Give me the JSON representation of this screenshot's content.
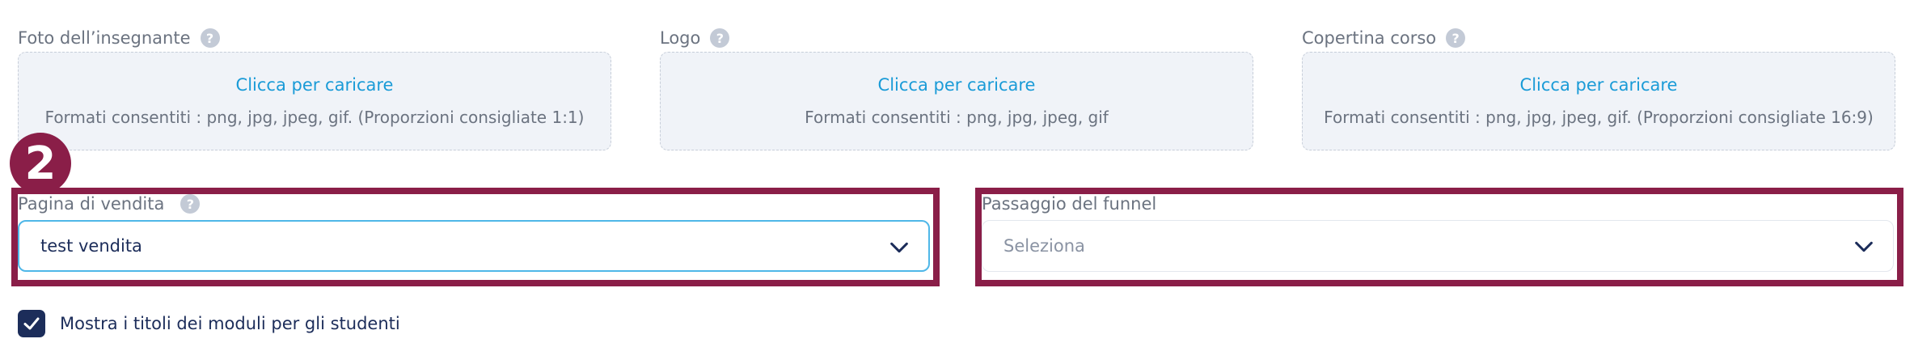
{
  "uploads": [
    {
      "label": "Foto dell’insegnante",
      "link": "Clicca per caricare",
      "hint": "Formati consentiti : png, jpg, jpeg, gif. (Proporzioni consigliate 1:1)"
    },
    {
      "label": "Logo",
      "link": "Clicca per caricare",
      "hint": "Formati consentiti : png, jpg, jpeg, gif"
    },
    {
      "label": "Copertina corso",
      "link": "Clicca per caricare",
      "hint": "Formati consentiti : png, jpg, jpeg, gif. (Proporzioni consigliate 16:9)"
    }
  ],
  "help_glyph": "?",
  "step_badge": "2",
  "sales_page": {
    "label": "Pagina di vendita",
    "value": "test vendita"
  },
  "funnel_step": {
    "label": "Passaggio del funnel",
    "placeholder": "Seleziona"
  },
  "show_titles": {
    "label": "Mostra i titoli dei moduli per gli studenti",
    "checked": true
  },
  "colors": {
    "accent_link": "#1a9bd7",
    "highlight": "#8a1e48",
    "checkbox": "#1c2d5a",
    "select_focus": "#4fb7e8"
  }
}
